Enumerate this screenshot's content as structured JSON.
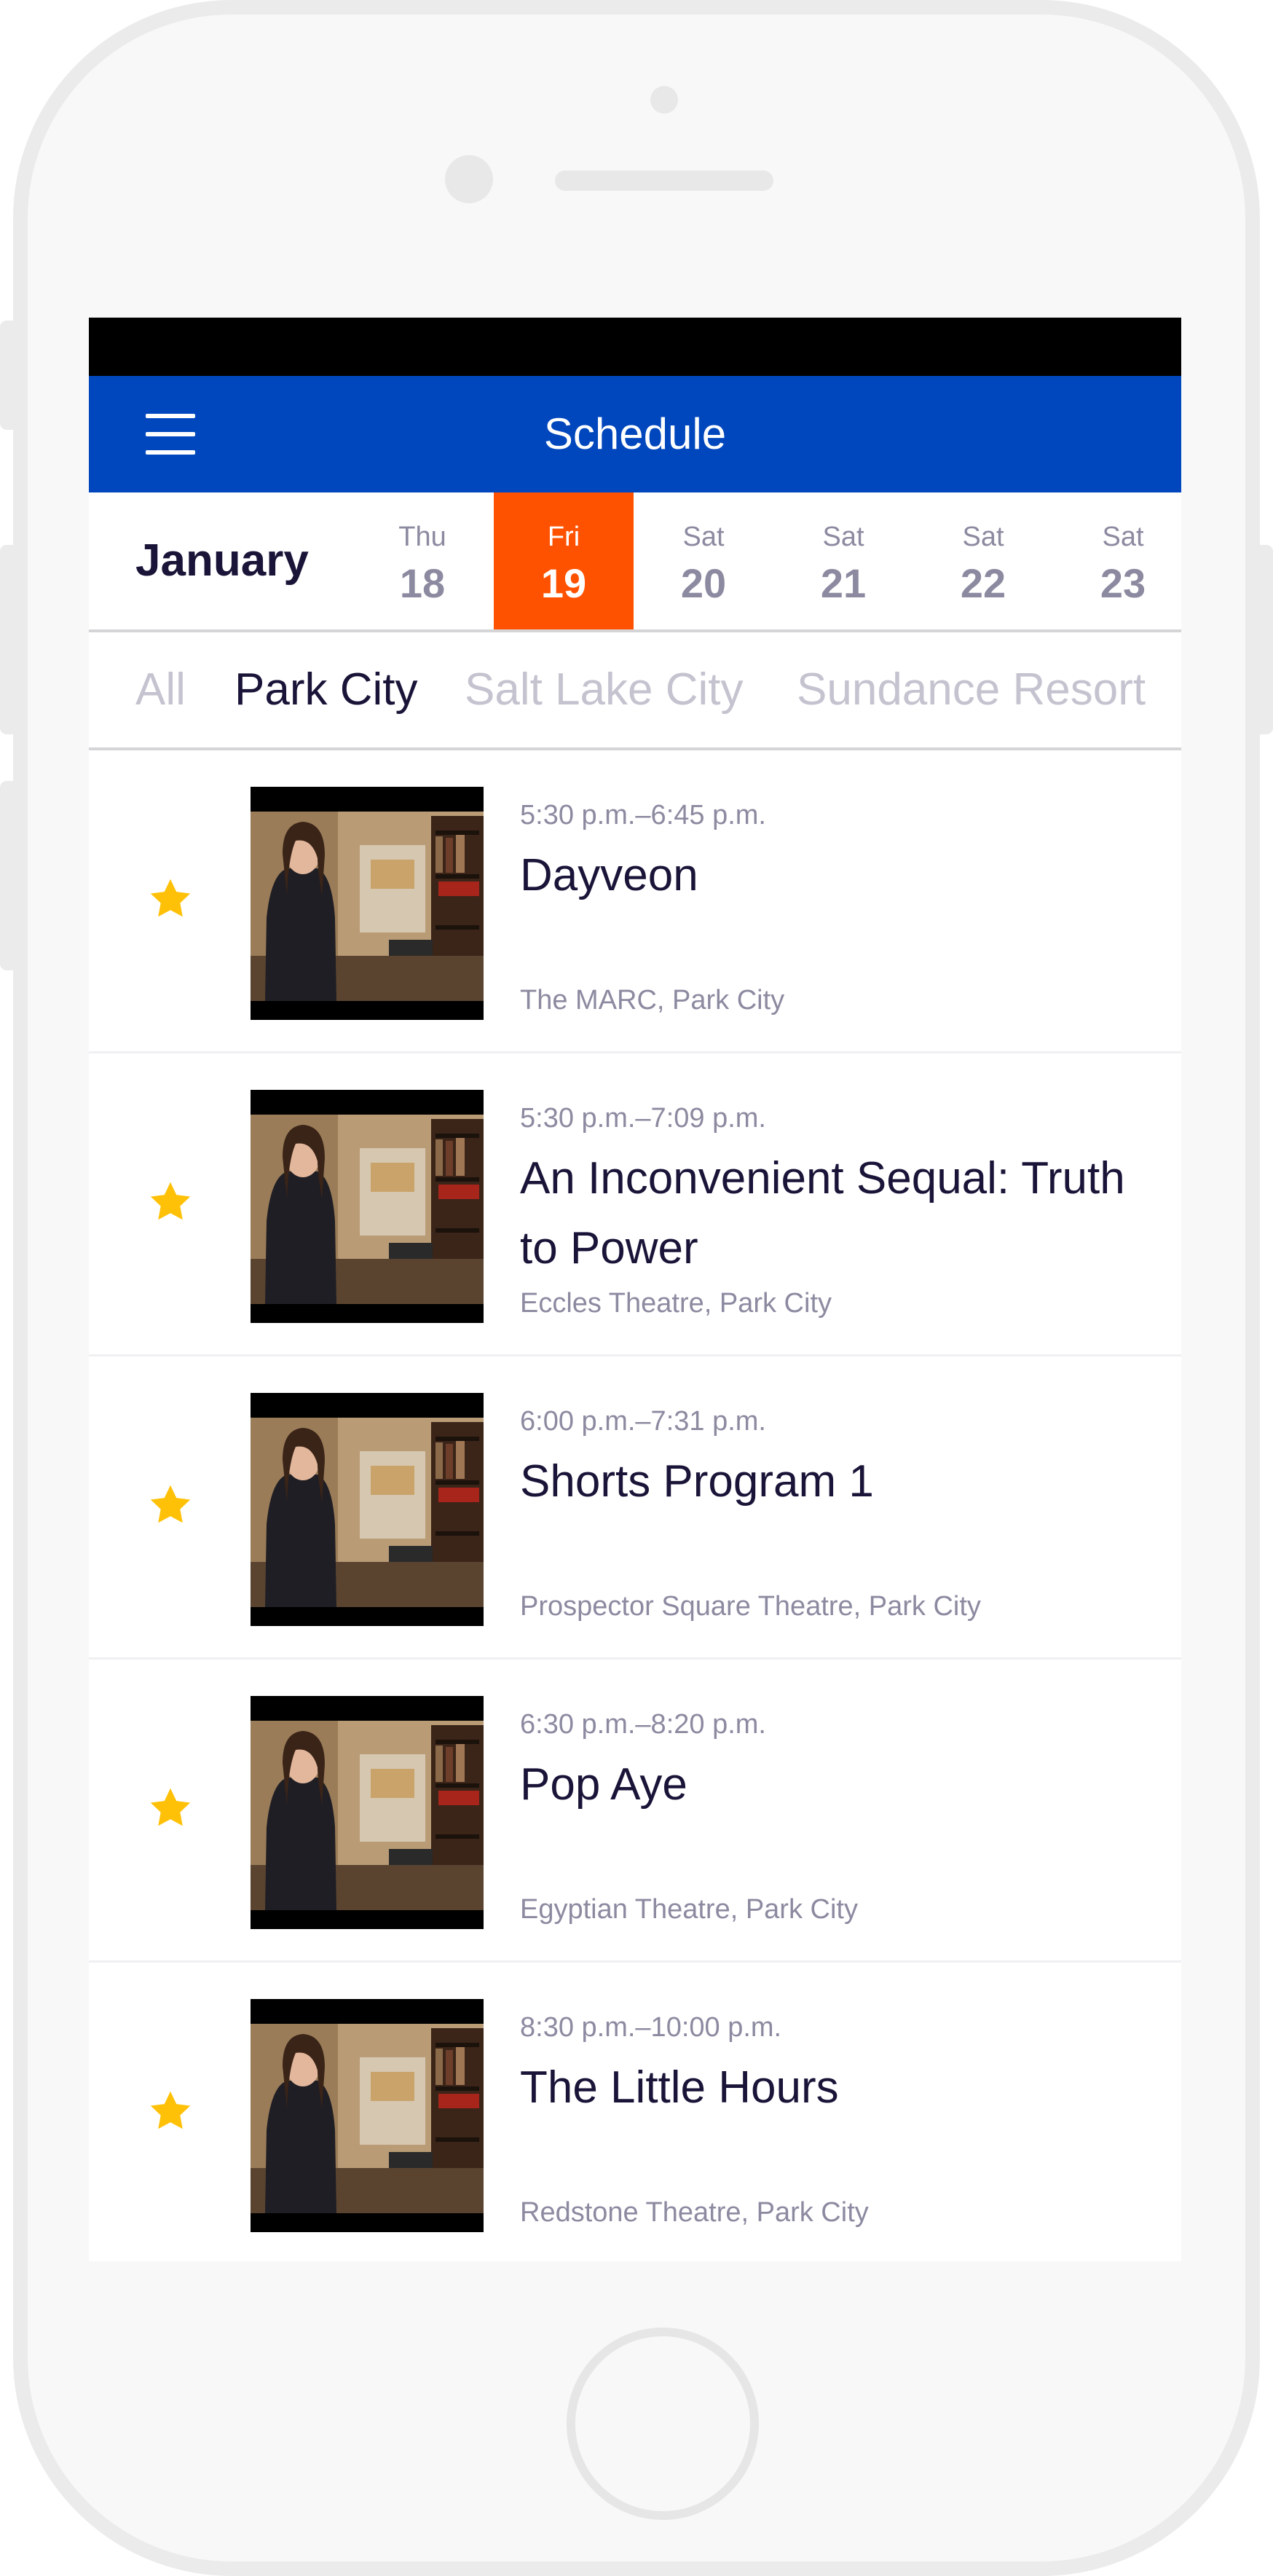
{
  "colors": {
    "header_bg": "#0047bd",
    "active_day_bg": "#ff5200",
    "star": "#ffc107",
    "title_text": "#1a1438",
    "muted_text": "#8c8aa0"
  },
  "header": {
    "title": "Schedule",
    "menu_icon": "hamburger-menu-icon"
  },
  "date_bar": {
    "month": "January",
    "days": [
      {
        "dow": "Thu",
        "num": "18",
        "selected": false
      },
      {
        "dow": "Fri",
        "num": "19",
        "selected": true
      },
      {
        "dow": "Sat",
        "num": "20",
        "selected": false
      },
      {
        "dow": "Sat",
        "num": "21",
        "selected": false
      },
      {
        "dow": "Sat",
        "num": "22",
        "selected": false
      },
      {
        "dow": "Sat",
        "num": "23",
        "selected": false
      }
    ]
  },
  "locations": {
    "items": [
      {
        "label": "All",
        "selected": false
      },
      {
        "label": "Park City",
        "selected": true
      },
      {
        "label": "Salt Lake City",
        "selected": false
      },
      {
        "label": "Sundance Resort",
        "selected": false
      }
    ]
  },
  "screenings": [
    {
      "time": "5:30 p.m.–6:45 p.m.",
      "title": "Dayveon",
      "venue": "The MARC, Park City",
      "starred": true
    },
    {
      "time": "5:30 p.m.–7:09 p.m.",
      "title": "An Inconvenient Sequal: Truth to Power",
      "venue": "Eccles Theatre, Park City",
      "starred": true
    },
    {
      "time": "6:00 p.m.–7:31 p.m.",
      "title": "Shorts Program 1",
      "venue": "Prospector Square Theatre, Park City",
      "starred": true
    },
    {
      "time": "6:30 p.m.–8:20 p.m.",
      "title": "Pop Aye",
      "venue": "Egyptian Theatre, Park City",
      "starred": true
    },
    {
      "time": "8:30 p.m.–10:00 p.m.",
      "title": "The Little Hours",
      "venue": "Redstone Theatre, Park City",
      "starred": true
    }
  ]
}
